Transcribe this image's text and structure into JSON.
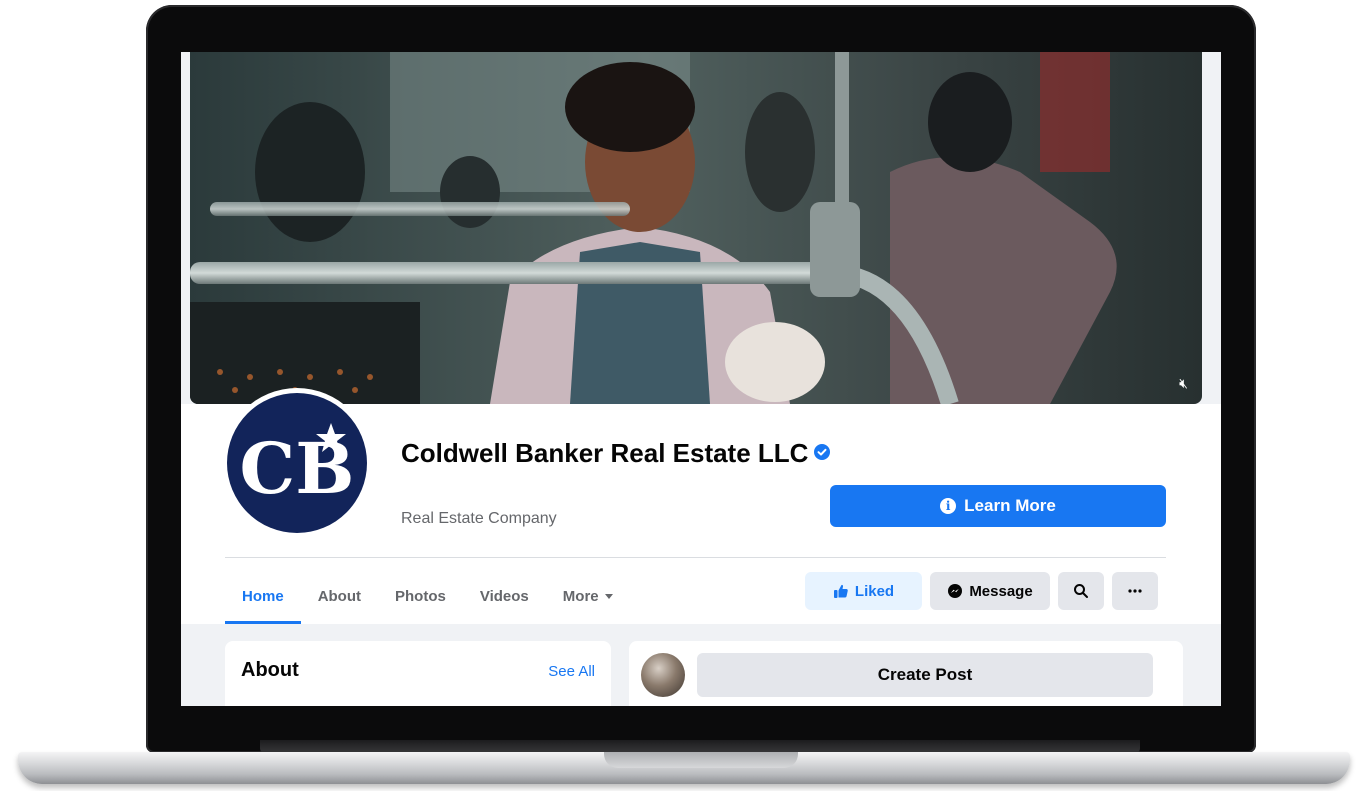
{
  "page": {
    "name": "Coldwell Banker Real Estate LLC",
    "category": "Real Estate Company",
    "verified": true,
    "avatar_logo": "CB"
  },
  "cover": {
    "media": "video",
    "muted_icon": "speaker-muted-icon"
  },
  "cta": {
    "label": "Learn More",
    "icon": "info-icon"
  },
  "tabs": [
    {
      "label": "Home",
      "active": true
    },
    {
      "label": "About"
    },
    {
      "label": "Photos"
    },
    {
      "label": "Videos"
    },
    {
      "label": "More",
      "icon": "caret-down-icon"
    }
  ],
  "actions": {
    "liked_label": "Liked",
    "message_label": "Message",
    "search_icon": "search-icon",
    "more_icon": "ellipsis-icon"
  },
  "about": {
    "title": "About",
    "see_all": "See All"
  },
  "composer": {
    "create_post": "Create Post"
  },
  "colors": {
    "accent": "#1877f2",
    "brand_navy": "#12245a",
    "liked_bg": "#e7f3ff",
    "button_bg": "#e4e6eb"
  }
}
